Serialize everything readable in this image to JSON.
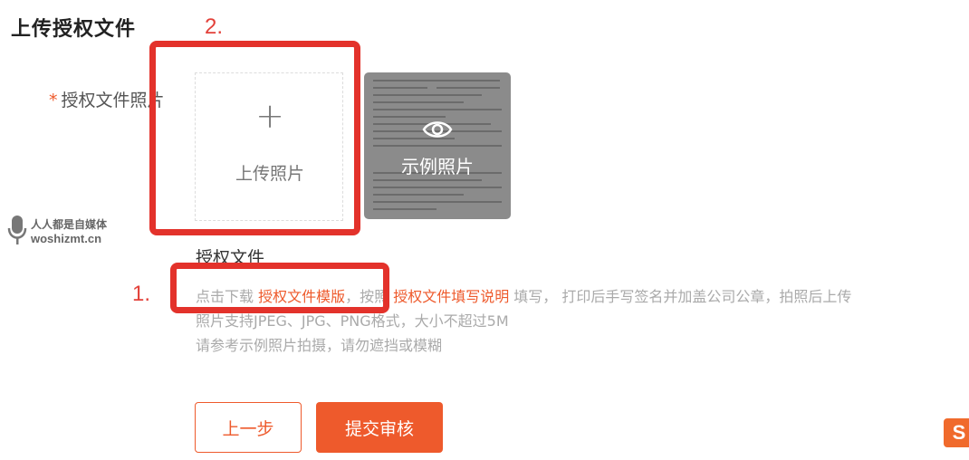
{
  "page": {
    "title": "上传授权文件"
  },
  "annotations": {
    "step1": "1.",
    "step2": "2.",
    "highlight_color": "#e3322b"
  },
  "form": {
    "required_mark": "*",
    "field_label": "授权文件照片",
    "upload_icon": "plus-icon",
    "upload_label": "上传照片",
    "sample_icon": "eye-icon",
    "sample_label": "示例照片"
  },
  "watermark": {
    "line1": "人人都是自媒体",
    "line2": "woshizmt.cn"
  },
  "auth_section": {
    "title": "授权文件",
    "line1_prefix": "点击下载 ",
    "template_link": "授权文件模版",
    "line1_mid": "，按照 ",
    "guide_link": "授权文件填写说明",
    "line1_suffix": " 填写， 打印后手写签名并加盖公司公章，拍照后上传",
    "line2": "照片支持JPEG、JPG、PNG格式，大小不超过5M",
    "line3": "请参考示例照片拍摄，请勿遮挡或模糊"
  },
  "buttons": {
    "prev": "上一步",
    "submit": "提交审核"
  },
  "ime": {
    "icon": "sogou-ime-icon",
    "label": "S"
  },
  "colors": {
    "accent": "#ee5a2c",
    "annotation_red": "#e3413a",
    "muted_text": "#aaaaaa"
  }
}
